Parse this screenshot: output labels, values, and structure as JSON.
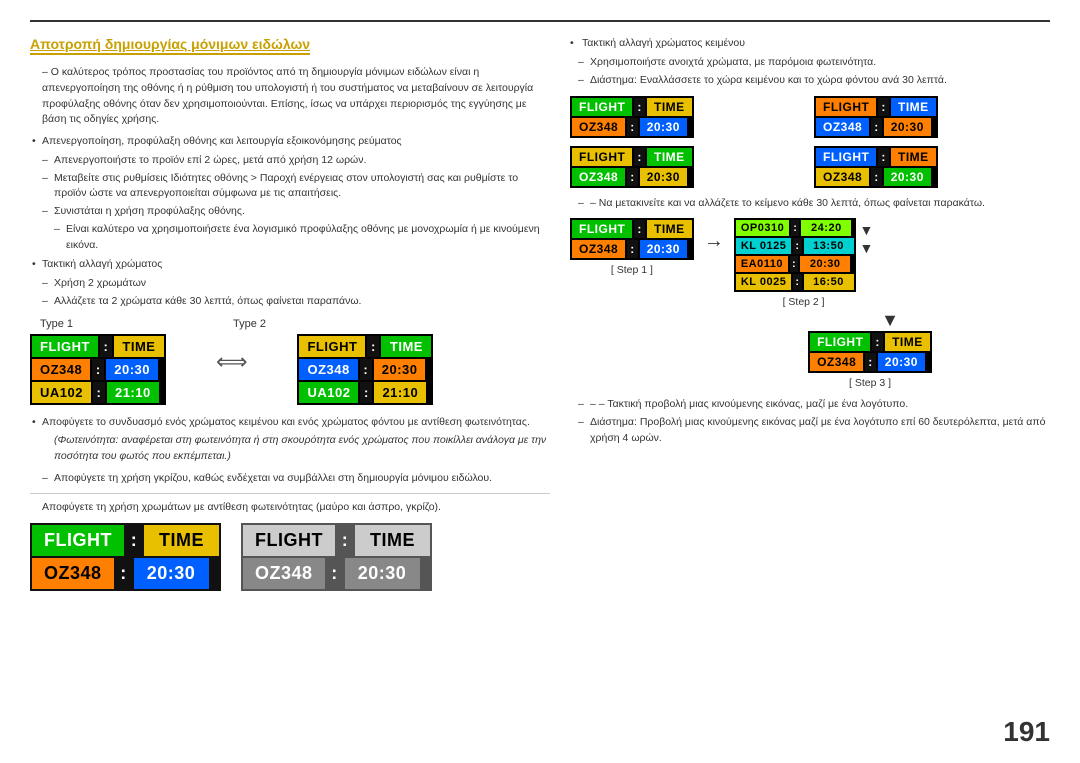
{
  "page": {
    "number": "191"
  },
  "section_title": "Αποτροπή δημιουργίας μόνιμων ειδώλων",
  "left": {
    "intro": "– Ο καλύτερος τρόπος προστασίας του προϊόντος από τη δημιουργία μόνιμων ειδώλων είναι η απενεργοποίηση της οθόνης ή η ρύθμιση του υπολογιστή ή του συστήματος να μεταβαίνουν σε λειτουργία προφύλαξης οθόνης όταν δεν χρησιμοποιούνται. Επίσης, ίσως να υπάρχει περιορισμός της εγγύησης με βάση τις οδηγίες χρήσης.",
    "bullet1": "Απενεργοποίηση, προφύλαξη οθόνης και λειτουργία εξοικονόμησης ρεύματος",
    "dash1": "Απενεργοποιήστε το προϊόν επί 2 ώρες, μετά από χρήση 12 ωρών.",
    "dash2": "Μεταβείτε στις ρυθμίσεις Ιδιότητες οθόνης > Παροχή ενέργειας στον υπολογιστή σας και ρυθμίστε το προϊόν ώστε να απενεργοποιείται σύμφωνα με τις απαιτήσεις.",
    "dash3": "Συνιστάται η χρήση προφύλαξης οθόνης.",
    "dash3b": "Είναι καλύτερο να χρησιμοποιήσετε ένα λογισμικό προφύλαξης οθόνης με μονοχρωμία ή με κινούμενη εικόνα.",
    "bullet2": "Τακτική αλλαγή χρώματος",
    "dash4": "Χρήση 2 χρωμάτων",
    "dash4b": "Αλλάζετε τα 2 χρώματα κάθε 30 λεπτά, όπως φαίνεται παραπάνω.",
    "type1_label": "Type 1",
    "type2_label": "Type 2",
    "board_header_flight": "FLIGHT",
    "board_header_colon": ":",
    "board_header_time": "TIME",
    "board_row1_code": "OZ348",
    "board_row1_time1": "20:30",
    "board_row2_code": "UA102",
    "board_row2_time2": "21:10",
    "bullet3": "Αποφύγετε το συνδυασμό ενός χρώματος κειμένου και ενός χρώματος φόντου με αντίθεση φωτεινότητας.",
    "paren_text": "(Φωτεινότητα: αναφέρεται στη φωτεινότητα ή στη σκουρότητα ενός χρώματος που ποικίλλει ανάλογα με την ποσότητα του φωτός που εκπέμπεται.)",
    "dash5": "Αποφύγετε τη χρήση γκρίζου, καθώς ενδέχεται να συμβάλλει στη δημιουργία μόνιμου ειδώλου.",
    "dash6": "Αποφύγετε τη χρήση χρωμάτων με αντίθεση φωτεινότητας (μαύρο και άσπρο, γκρίζο).",
    "bottom_left_header_flight": "FLIGHT",
    "bottom_left_header_colon": ":",
    "bottom_left_header_time": "TIME",
    "bottom_left_row_code": "OZ348",
    "bottom_left_row_colon": ":",
    "bottom_left_row_time": "20:30",
    "bottom_right_header_flight": "FLIGHT",
    "bottom_right_header_colon": ":",
    "bottom_right_header_time": "TIME",
    "bottom_right_row_code": "OZ348",
    "bottom_right_row_colon": ":",
    "bottom_right_row_time": "20:30"
  },
  "right": {
    "bullet1": "Τακτική αλλαγή χρώματος κειμένου",
    "dash1": "Χρησιμοποιήστε ανοιχτά χρώματα, με παρόμοια φωτεινότητα.",
    "dash2": "Διάστημα: Εναλλάσσετε το χώρα κειμένου και το χώρα φόντου ανά 30 λεπτά.",
    "grid_boards": [
      {
        "header": [
          "FLIGHT",
          ":",
          "TIME"
        ],
        "row": [
          "OZ348",
          ":",
          "20:30"
        ],
        "style": "green-yellow"
      },
      {
        "header": [
          "FLIGHT",
          ":",
          "TIME"
        ],
        "row": [
          "OZ348",
          ":",
          "20:30"
        ],
        "style": "orange-blue"
      },
      {
        "header": [
          "FLIGHT",
          ":",
          "TIME"
        ],
        "row": [
          "OZ348",
          ":",
          "20:30"
        ],
        "style": "blue-green"
      },
      {
        "header": [
          "FLIGHT",
          ":",
          "TIME"
        ],
        "row": [
          "OZ348",
          ":",
          "20:30"
        ],
        "style": "yellow-orange"
      }
    ],
    "dash3": "– Να μετακινείτε και να αλλάζετε το κείμενο κάθε 30 λεπτά, όπως φαίνεται παρακάτω.",
    "step1_label": "[ Step 1 ]",
    "step2_label": "[ Step 2 ]",
    "step3_label": "[ Step 3 ]",
    "step1_board": {
      "header": [
        "FLIGHT",
        ":",
        "TIME"
      ],
      "row": [
        "OZ348",
        ":",
        "20:30"
      ]
    },
    "step2_board_rows": [
      {
        "code": "OP0310",
        "colon": ":",
        "time": "24:20",
        "bg": "lime"
      },
      {
        "code": "KL0125",
        "colon": ":",
        "time": "13:50",
        "bg": "cyan"
      },
      {
        "code": "EA0110",
        "colon": ":",
        "time": "20:30",
        "bg": "orange"
      },
      {
        "code": "KL0025",
        "colon": ":",
        "time": "16:50",
        "bg": "yellow"
      }
    ],
    "step3_board": {
      "header": [
        "FLIGHT",
        ":",
        "TIME"
      ],
      "row": [
        "OZ348",
        ":",
        "20:30"
      ]
    },
    "bottom_bullet1": "– Τακτική προβολή μιας κινούμενης εικόνας, μαζί με ένα λογότυπο.",
    "bottom_dash1": "Διάστημα: Προβολή μιας κινούμενης εικόνας μαζί με ένα λογότυπο επί 60 δευτερόλεπτα, μετά από χρήση 4 ωρών."
  }
}
